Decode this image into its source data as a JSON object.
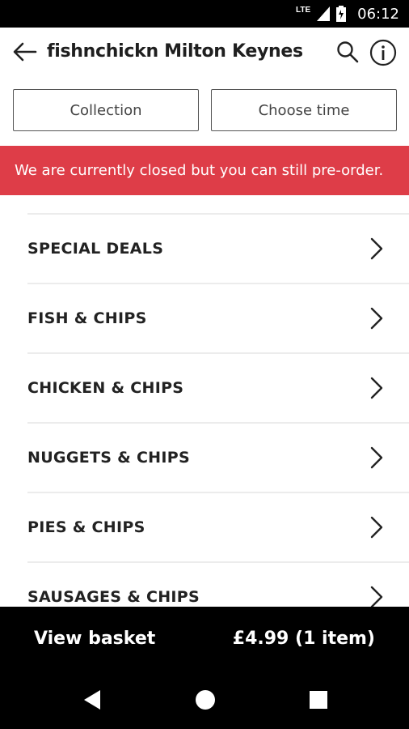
{
  "status_bar": {
    "network": "LTE",
    "time": "06:12",
    "icons": [
      "signal-icon",
      "battery-icon"
    ]
  },
  "app_bar": {
    "title": "fishnchickn Milton Keynes",
    "icons": [
      "back-arrow-icon",
      "search-icon",
      "info-icon"
    ]
  },
  "options": {
    "collection_label": "Collection",
    "time_label": "Choose time"
  },
  "banner": {
    "text": "We are currently closed but you can still pre-order.",
    "color": "#de3d48"
  },
  "menu": {
    "items": [
      {
        "label": "SPECIAL DEALS"
      },
      {
        "label": "FISH & CHIPS"
      },
      {
        "label": "CHICKEN & CHIPS"
      },
      {
        "label": "NUGGETS & CHIPS"
      },
      {
        "label": "PIES & CHIPS"
      },
      {
        "label": "SAUSAGES & CHIPS"
      }
    ]
  },
  "basket": {
    "view_label": "View basket",
    "summary": "£4.99 (1 item)"
  },
  "nav_bar": {
    "icons": [
      "nav-back-icon",
      "nav-home-icon",
      "nav-recents-icon"
    ]
  }
}
